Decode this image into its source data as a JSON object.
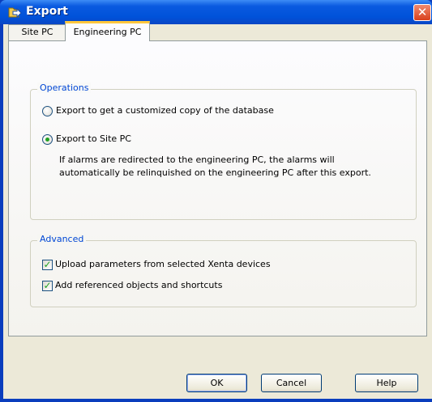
{
  "window": {
    "title": "Export",
    "close_glyph": "✕",
    "icon": "export-arrow-icon"
  },
  "tabs": [
    {
      "label": "Site PC",
      "active": false
    },
    {
      "label": "Engineering PC",
      "active": true
    }
  ],
  "operations": {
    "legend": "Operations",
    "options": [
      {
        "label": "Export to get a customized copy of the database",
        "selected": false
      },
      {
        "label": "Export to Site PC",
        "selected": true
      }
    ],
    "description_lines": [
      "If alarms are redirected to the engineering PC, the alarms will",
      "automatically be relinquished on the engineering PC after this export."
    ]
  },
  "advanced": {
    "legend": "Advanced",
    "checkboxes": [
      {
        "label": "Upload parameters from selected Xenta devices",
        "checked": true
      },
      {
        "label": "Add referenced objects and shortcuts",
        "checked": true
      }
    ]
  },
  "buttons": {
    "ok": "OK",
    "cancel": "Cancel",
    "help": "Help"
  },
  "colors": {
    "title_bar": "#0052d9",
    "legend_text": "#0046d5",
    "check_green": "#21a121",
    "active_tab_accent": "#ffc73c"
  }
}
